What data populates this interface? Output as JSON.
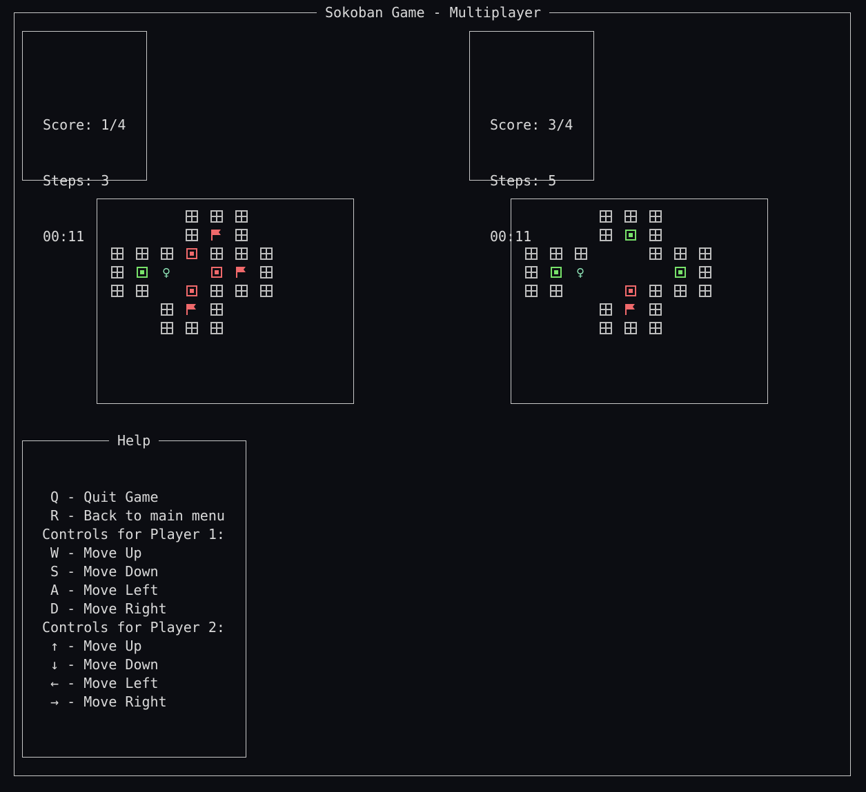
{
  "app": {
    "title": "Sokoban Game - Multiplayer"
  },
  "player1": {
    "score": "Score: 1/4",
    "steps": "Steps: 3",
    "time": "00:11",
    "cells": [
      {
        "t": "wall",
        "c": 3,
        "r": 0
      },
      {
        "t": "wall",
        "c": 4,
        "r": 0
      },
      {
        "t": "wall",
        "c": 5,
        "r": 0
      },
      {
        "t": "wall",
        "c": 3,
        "r": 1
      },
      {
        "t": "flag",
        "c": 4,
        "r": 1
      },
      {
        "t": "wall",
        "c": 5,
        "r": 1
      },
      {
        "t": "wall",
        "c": 0,
        "r": 2
      },
      {
        "t": "wall",
        "c": 1,
        "r": 2
      },
      {
        "t": "wall",
        "c": 2,
        "r": 2
      },
      {
        "t": "box-red",
        "c": 3,
        "r": 2
      },
      {
        "t": "wall",
        "c": 4,
        "r": 2
      },
      {
        "t": "wall",
        "c": 5,
        "r": 2
      },
      {
        "t": "wall",
        "c": 6,
        "r": 2
      },
      {
        "t": "wall",
        "c": 0,
        "r": 3
      },
      {
        "t": "box-green",
        "c": 1,
        "r": 3
      },
      {
        "t": "player",
        "c": 2,
        "r": 3
      },
      {
        "t": "box-red",
        "c": 4,
        "r": 3
      },
      {
        "t": "flag",
        "c": 5,
        "r": 3
      },
      {
        "t": "wall",
        "c": 6,
        "r": 3
      },
      {
        "t": "wall",
        "c": 0,
        "r": 4
      },
      {
        "t": "wall",
        "c": 1,
        "r": 4
      },
      {
        "t": "box-red",
        "c": 3,
        "r": 4
      },
      {
        "t": "wall",
        "c": 4,
        "r": 4
      },
      {
        "t": "wall",
        "c": 5,
        "r": 4
      },
      {
        "t": "wall",
        "c": 6,
        "r": 4
      },
      {
        "t": "wall",
        "c": 2,
        "r": 5
      },
      {
        "t": "flag",
        "c": 3,
        "r": 5
      },
      {
        "t": "wall",
        "c": 4,
        "r": 5
      },
      {
        "t": "wall",
        "c": 2,
        "r": 6
      },
      {
        "t": "wall",
        "c": 3,
        "r": 6
      },
      {
        "t": "wall",
        "c": 4,
        "r": 6
      }
    ]
  },
  "player2": {
    "score": "Score: 3/4",
    "steps": "Steps: 5",
    "time": "00:11",
    "cells": [
      {
        "t": "wall",
        "c": 3,
        "r": 0
      },
      {
        "t": "wall",
        "c": 4,
        "r": 0
      },
      {
        "t": "wall",
        "c": 5,
        "r": 0
      },
      {
        "t": "wall",
        "c": 3,
        "r": 1
      },
      {
        "t": "box-green",
        "c": 4,
        "r": 1
      },
      {
        "t": "wall",
        "c": 5,
        "r": 1
      },
      {
        "t": "wall",
        "c": 0,
        "r": 2
      },
      {
        "t": "wall",
        "c": 1,
        "r": 2
      },
      {
        "t": "wall",
        "c": 2,
        "r": 2
      },
      {
        "t": "wall",
        "c": 5,
        "r": 2
      },
      {
        "t": "wall",
        "c": 6,
        "r": 2
      },
      {
        "t": "wall",
        "c": 7,
        "r": 2
      },
      {
        "t": "wall",
        "c": 0,
        "r": 3
      },
      {
        "t": "box-green",
        "c": 1,
        "r": 3
      },
      {
        "t": "player",
        "c": 2,
        "r": 3
      },
      {
        "t": "box-green",
        "c": 6,
        "r": 3
      },
      {
        "t": "wall",
        "c": 7,
        "r": 3
      },
      {
        "t": "wall",
        "c": 0,
        "r": 4
      },
      {
        "t": "wall",
        "c": 1,
        "r": 4
      },
      {
        "t": "box-red",
        "c": 4,
        "r": 4
      },
      {
        "t": "wall",
        "c": 5,
        "r": 4
      },
      {
        "t": "wall",
        "c": 6,
        "r": 4
      },
      {
        "t": "wall",
        "c": 7,
        "r": 4
      },
      {
        "t": "wall",
        "c": 3,
        "r": 5
      },
      {
        "t": "flag",
        "c": 4,
        "r": 5
      },
      {
        "t": "wall",
        "c": 5,
        "r": 5
      },
      {
        "t": "wall",
        "c": 3,
        "r": 6
      },
      {
        "t": "wall",
        "c": 4,
        "r": 6
      },
      {
        "t": "wall",
        "c": 5,
        "r": 6
      }
    ]
  },
  "help": {
    "title": "Help",
    "lines": [
      " Q - Quit Game",
      " R - Back to main menu",
      "Controls for Player 1:",
      " W - Move Up",
      " S - Move Down",
      " A - Move Left",
      " D - Move Right",
      "Controls for Player 2:",
      " ↑ - Move Up",
      " ↓ - Move Down",
      " ← - Move Left",
      " → - Move Right"
    ]
  },
  "colors": {
    "background": "#0c0d12",
    "border": "#c9c9c9",
    "wall": "#bdbdbd",
    "box_red": "#f0696b",
    "box_green": "#78e26a",
    "flag": "#f0696b",
    "player": "#8ee3b6"
  },
  "icons": {
    "wall": "wall-icon",
    "box_on_target": "box-on-target-icon",
    "box": "box-icon",
    "target": "flag-icon",
    "player": "player-icon"
  }
}
